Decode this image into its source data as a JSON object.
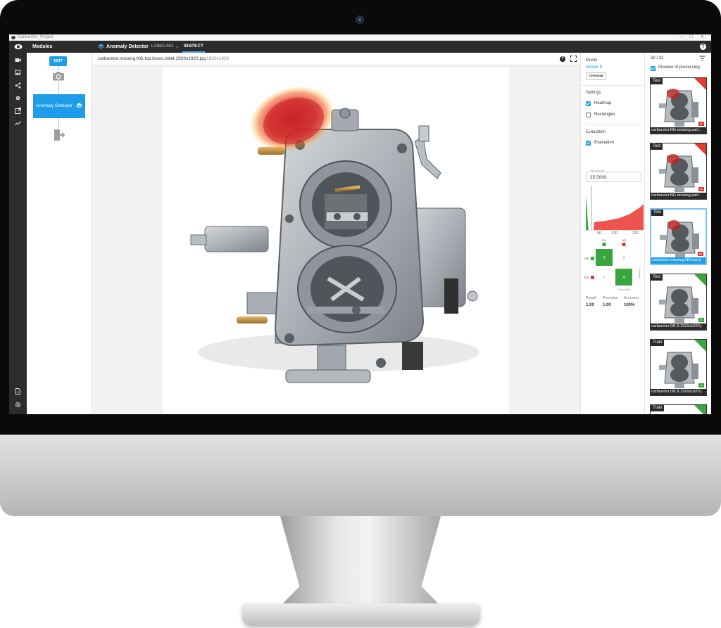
{
  "window": {
    "title": "Carburetor_Project",
    "controls": [
      "—",
      "☐",
      "✕"
    ]
  },
  "topbar": {
    "modules_label": "Modules",
    "project_name": "Anomaly Detector",
    "tab_labeling": "LABELING",
    "tab_inspect": "INSPECT",
    "help": "?"
  },
  "rail_icons": [
    "video-camera-icon",
    "images-icon",
    "share-icon",
    "gear-icon",
    "export-icon",
    "trend-chart-icon",
    "document-icon",
    "settings-icon"
  ],
  "modules": {
    "edit_label": "EDIT",
    "detector_label": "Anomaly Detector"
  },
  "viewer": {
    "filename": "carburetor.missing.NG.top.brass.intlet.1920x1920.jpg",
    "resolution": "1920x1920",
    "help": "?"
  },
  "settings": {
    "model_title": "Model",
    "model_name": "Model 5",
    "change_label": "CHANGE",
    "settings_title": "Settings",
    "heatmap_label": "Heatmap",
    "heatmap_on": true,
    "rectangles_label": "Rectangles",
    "rectangles_on": false,
    "evaluation_title": "Evaluation",
    "evaluation_label": "Evaluation",
    "evaluation_on": true,
    "threshold_caption": "Threshold",
    "threshold_value": "25.5000",
    "hist_ticks": [
      "60",
      "120",
      "232"
    ],
    "matrix": {
      "ok_label": "OK",
      "ng_label": "NG",
      "cells": [
        [
          "3",
          "0"
        ],
        [
          "0",
          "4"
        ]
      ],
      "col_caption": "Ground truth",
      "row_caption": "Predicted"
    },
    "metrics": [
      {
        "name": "Recall",
        "value": "1.00"
      },
      {
        "name": "Precision",
        "value": "1.00"
      },
      {
        "name": "Accuracy",
        "value": "100%"
      }
    ],
    "colors": {
      "accent": "#1e9be9",
      "ok": "#3aa53f",
      "ng": "#e53935"
    }
  },
  "thumbs": {
    "count": "32 / 32",
    "preview_label": "Preview of processing",
    "preview_on": true,
    "items": [
      {
        "tag": "Test",
        "caption": "carburetor.NG.missing.part...",
        "corner": "#e53935",
        "badge": "NG",
        "selected": false,
        "heat": true
      },
      {
        "tag": "Test",
        "caption": "carburetor.NG.missing.part...",
        "corner": "#e53935",
        "badge": "NG",
        "selected": false,
        "heat": true
      },
      {
        "tag": "Test",
        "caption": "carburetor.missing.NG.top.b",
        "corner": "",
        "badge": "NG",
        "selected": true,
        "heat": true
      },
      {
        "tag": "Test",
        "caption": "carburetor.OK.9.1920x1920.j",
        "corner": "#3aa53f",
        "badge": "OK",
        "selected": false,
        "heat": false
      },
      {
        "tag": "Train",
        "caption": "carburetor.OK.8.1920x1920.j",
        "corner": "#3aa53f",
        "badge": "OK",
        "selected": false,
        "heat": false
      },
      {
        "tag": "Train",
        "caption": "",
        "corner": "#3aa53f",
        "badge": "",
        "selected": false,
        "heat": false
      }
    ]
  }
}
